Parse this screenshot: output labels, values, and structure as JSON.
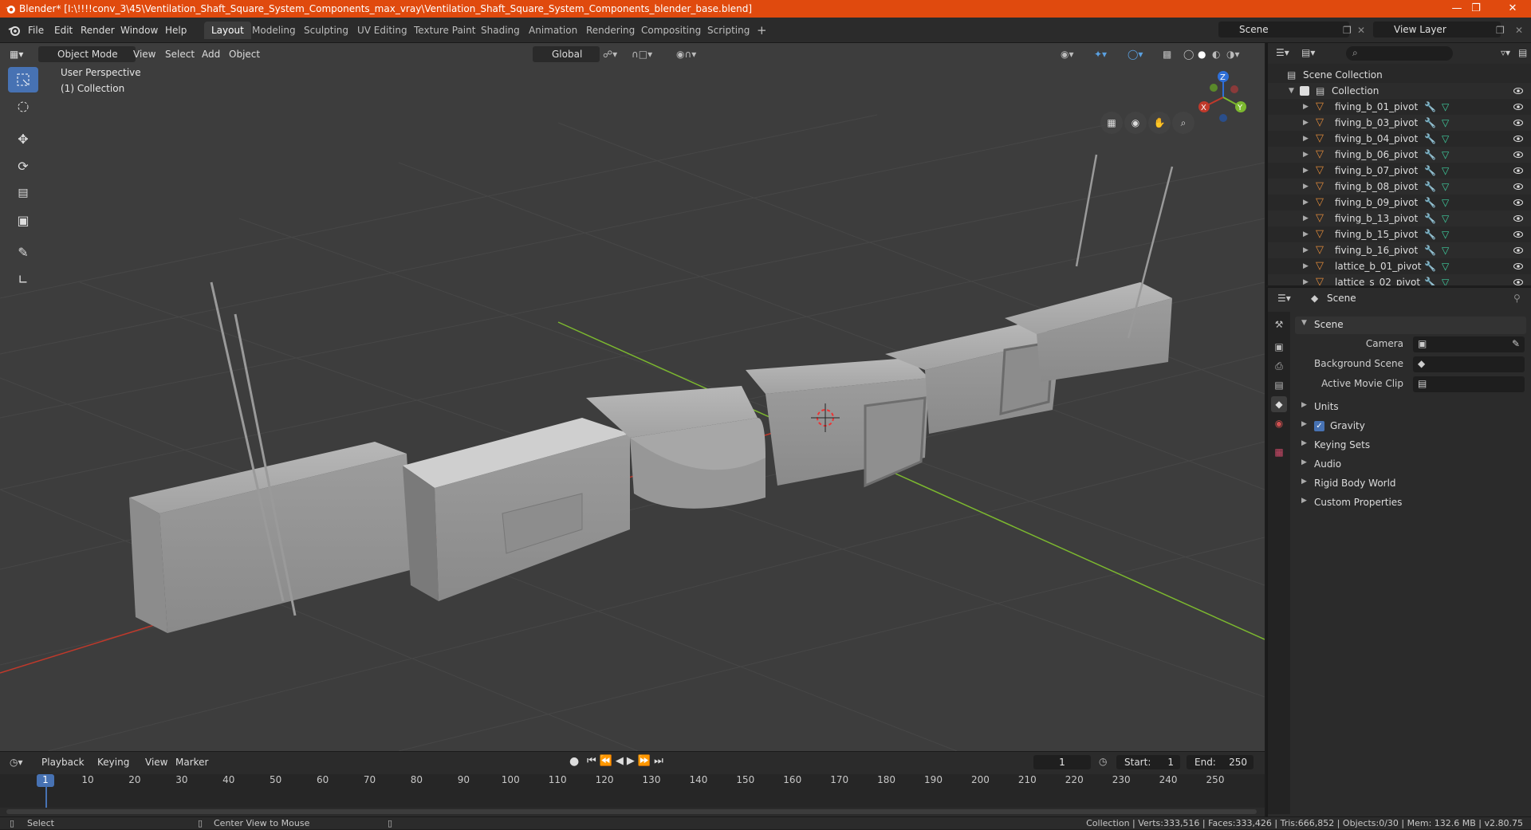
{
  "window": {
    "title": "Blender* [I:\\!!!!conv_3\\45\\Ventilation_Shaft_Square_System_Components_max_vray\\Ventilation_Shaft_Square_System_Components_blender_base.blend]"
  },
  "menu": [
    "File",
    "Edit",
    "Render",
    "Window",
    "Help"
  ],
  "workspaces": [
    "Layout",
    "Modeling",
    "Sculpting",
    "UV Editing",
    "Texture Paint",
    "Shading",
    "Animation",
    "Rendering",
    "Compositing",
    "Scripting"
  ],
  "workspace_add": "+",
  "scene_field": "Scene",
  "view_layer_field": "View Layer",
  "viewport": {
    "mode": "Object Mode",
    "menus": [
      "View",
      "Select",
      "Add",
      "Object"
    ],
    "orientation": "Global",
    "perspective_label": "User Perspective",
    "collection_label": "(1) Collection",
    "gizmo": {
      "x": "X",
      "y": "Y",
      "z": "Z"
    }
  },
  "timeline": {
    "menus": [
      "Playback",
      "Keying",
      "View",
      "Marker"
    ],
    "current_frame": "1",
    "start_label": "Start:",
    "start": "1",
    "end_label": "End:",
    "end": "250",
    "ticks": [
      "1",
      "10",
      "20",
      "30",
      "40",
      "50",
      "60",
      "70",
      "80",
      "90",
      "100",
      "110",
      "120",
      "130",
      "140",
      "150",
      "160",
      "170",
      "180",
      "190",
      "200",
      "210",
      "220",
      "230",
      "240",
      "250"
    ]
  },
  "outliner": {
    "scene_collection": "Scene Collection",
    "collection": "Collection",
    "items": [
      "fiving_b_01_pivot",
      "fiving_b_03_pivot",
      "fiving_b_04_pivot",
      "fiving_b_06_pivot",
      "fiving_b_07_pivot",
      "fiving_b_08_pivot",
      "fiving_b_09_pivot",
      "fiving_b_13_pivot",
      "fiving_b_15_pivot",
      "fiving_b_16_pivot",
      "lattice_b_01_pivot",
      "lattice_s_02_pivot"
    ]
  },
  "properties": {
    "context": "Scene",
    "panel_title": "Scene",
    "fields": {
      "camera": "Camera",
      "background_scene": "Background Scene",
      "active_movie_clip": "Active Movie Clip"
    },
    "panels": [
      "Units",
      "Gravity",
      "Keying Sets",
      "Audio",
      "Rigid Body World",
      "Custom Properties"
    ]
  },
  "status": {
    "select": "Select",
    "center_view": "Center View to Mouse",
    "stats": "Collection | Verts:333,516 | Faces:333,426 | Tris:666,852 | Objects:0/30 | Mem: 132.6 MB | v2.80.75"
  },
  "colors": {
    "title_bar": "#e04a0e",
    "accent_blue": "#4772b3",
    "x_axis": "#c0392b",
    "y_axis": "#7cb82f",
    "z_axis": "#2e6fd8",
    "object_orange": "#e08a3a",
    "modifier_blue": "#5aa0e0",
    "mesh_green": "#3fd0a0"
  }
}
